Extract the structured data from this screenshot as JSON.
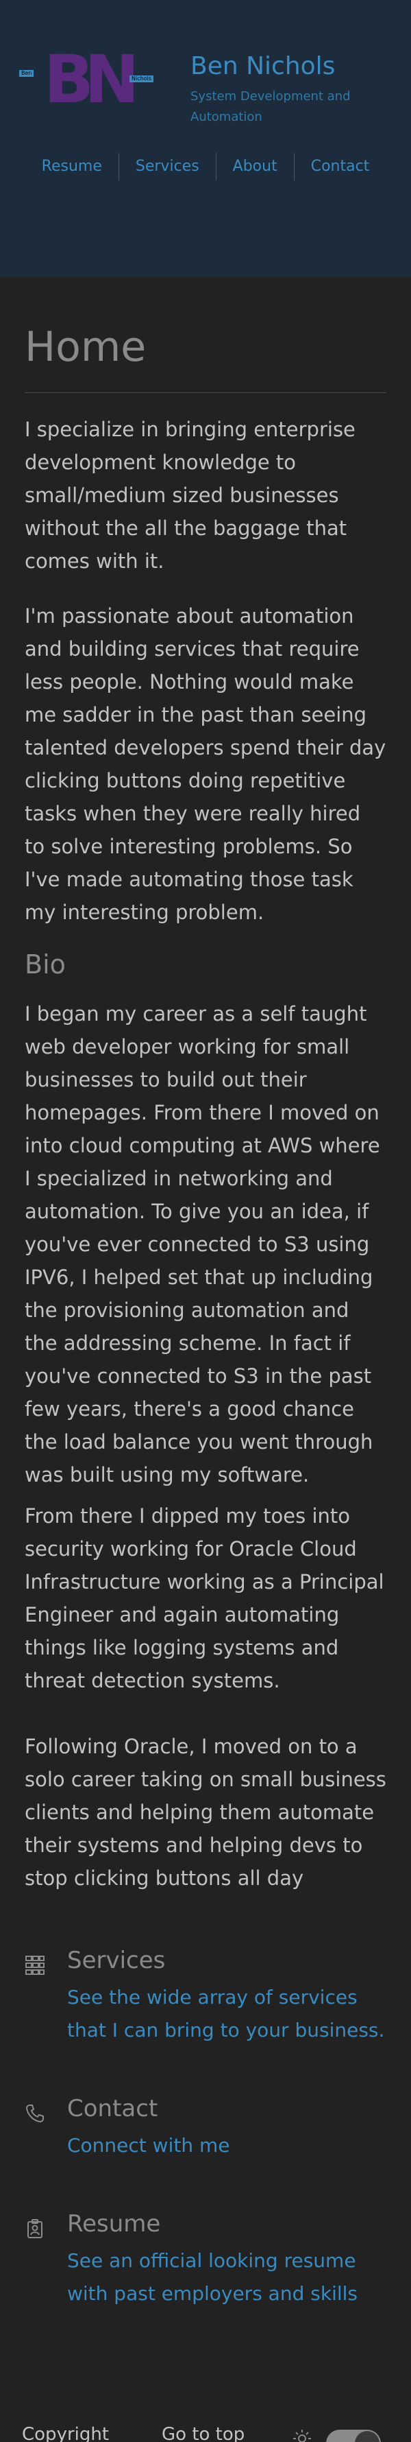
{
  "header": {
    "logo_letters": "BN",
    "logo_small_left": "Ben",
    "logo_small_right": "Nichols",
    "site_name": "Ben Nichols",
    "tagline": "System Development and Automation"
  },
  "nav": {
    "items": [
      {
        "label": "Resume"
      },
      {
        "label": "Services"
      },
      {
        "label": "About"
      },
      {
        "label": "Contact"
      }
    ]
  },
  "main": {
    "title": "Home",
    "intro": [
      "I specialize in bringing enterprise development knowledge to small/medium sized businesses without the all the baggage that comes with it.",
      "I'm passionate about automation and building services that require less people. Nothing would make me sadder in the past than seeing talented developers spend their day clicking buttons doing repetitive tasks when they were really hired to solve interesting problems. So I've made automating those task my interesting problem."
    ],
    "bio_heading": "Bio",
    "bio": [
      "I began my career as a self taught web developer working for small businesses to build out their homepages. From there I moved on into cloud computing at AWS where I specialized in networking and automation. To give you an idea, if you've ever connected to S3 using IPV6, I helped set that up including the provisioning automation and the addressing scheme. In fact if you've connected to S3 in the past few years, there's a good chance the load balance you went through was built using my software.",
      "From there I dipped my toes into security working for Oracle Cloud Infrastructure working as a Principal Engineer and again automating things like logging systems and threat detection systems.",
      "Following Oracle, I moved on to a solo career taking on small business clients and helping them automate their systems and helping devs to stop clicking buttons all day"
    ]
  },
  "cards": [
    {
      "icon": "grid-icon",
      "title": "Services",
      "link": "See the wide array of services that I can bring to your business."
    },
    {
      "icon": "phone-icon",
      "title": "Contact",
      "link": "Connect with me"
    },
    {
      "icon": "badge-icon",
      "title": "Resume",
      "link": "See an official looking resume with past employers and skills"
    }
  ],
  "footer": {
    "copyright": "Copyright",
    "go_top": "Go to top",
    "theme_icon": "sun-icon"
  },
  "colors": {
    "background": "#222222",
    "header_bg": "#1d2c3c",
    "accent": "#3a8bc1",
    "logo": "#5a2a7e"
  }
}
